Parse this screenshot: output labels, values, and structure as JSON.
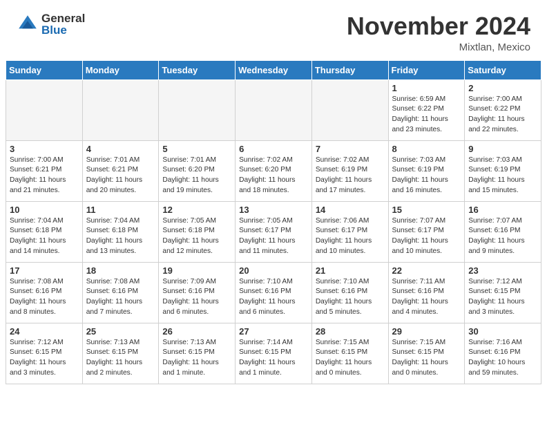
{
  "header": {
    "logo_general": "General",
    "logo_blue": "Blue",
    "month_title": "November 2024",
    "location": "Mixtlan, Mexico"
  },
  "days_of_week": [
    "Sunday",
    "Monday",
    "Tuesday",
    "Wednesday",
    "Thursday",
    "Friday",
    "Saturday"
  ],
  "weeks": [
    [
      {
        "day": "",
        "info": "",
        "empty": true
      },
      {
        "day": "",
        "info": "",
        "empty": true
      },
      {
        "day": "",
        "info": "",
        "empty": true
      },
      {
        "day": "",
        "info": "",
        "empty": true
      },
      {
        "day": "",
        "info": "",
        "empty": true
      },
      {
        "day": "1",
        "info": "Sunrise: 6:59 AM\nSunset: 6:22 PM\nDaylight: 11 hours\nand 23 minutes."
      },
      {
        "day": "2",
        "info": "Sunrise: 7:00 AM\nSunset: 6:22 PM\nDaylight: 11 hours\nand 22 minutes."
      }
    ],
    [
      {
        "day": "3",
        "info": "Sunrise: 7:00 AM\nSunset: 6:21 PM\nDaylight: 11 hours\nand 21 minutes."
      },
      {
        "day": "4",
        "info": "Sunrise: 7:01 AM\nSunset: 6:21 PM\nDaylight: 11 hours\nand 20 minutes."
      },
      {
        "day": "5",
        "info": "Sunrise: 7:01 AM\nSunset: 6:20 PM\nDaylight: 11 hours\nand 19 minutes."
      },
      {
        "day": "6",
        "info": "Sunrise: 7:02 AM\nSunset: 6:20 PM\nDaylight: 11 hours\nand 18 minutes."
      },
      {
        "day": "7",
        "info": "Sunrise: 7:02 AM\nSunset: 6:19 PM\nDaylight: 11 hours\nand 17 minutes."
      },
      {
        "day": "8",
        "info": "Sunrise: 7:03 AM\nSunset: 6:19 PM\nDaylight: 11 hours\nand 16 minutes."
      },
      {
        "day": "9",
        "info": "Sunrise: 7:03 AM\nSunset: 6:19 PM\nDaylight: 11 hours\nand 15 minutes."
      }
    ],
    [
      {
        "day": "10",
        "info": "Sunrise: 7:04 AM\nSunset: 6:18 PM\nDaylight: 11 hours\nand 14 minutes."
      },
      {
        "day": "11",
        "info": "Sunrise: 7:04 AM\nSunset: 6:18 PM\nDaylight: 11 hours\nand 13 minutes."
      },
      {
        "day": "12",
        "info": "Sunrise: 7:05 AM\nSunset: 6:18 PM\nDaylight: 11 hours\nand 12 minutes."
      },
      {
        "day": "13",
        "info": "Sunrise: 7:05 AM\nSunset: 6:17 PM\nDaylight: 11 hours\nand 11 minutes."
      },
      {
        "day": "14",
        "info": "Sunrise: 7:06 AM\nSunset: 6:17 PM\nDaylight: 11 hours\nand 10 minutes."
      },
      {
        "day": "15",
        "info": "Sunrise: 7:07 AM\nSunset: 6:17 PM\nDaylight: 11 hours\nand 10 minutes."
      },
      {
        "day": "16",
        "info": "Sunrise: 7:07 AM\nSunset: 6:16 PM\nDaylight: 11 hours\nand 9 minutes."
      }
    ],
    [
      {
        "day": "17",
        "info": "Sunrise: 7:08 AM\nSunset: 6:16 PM\nDaylight: 11 hours\nand 8 minutes."
      },
      {
        "day": "18",
        "info": "Sunrise: 7:08 AM\nSunset: 6:16 PM\nDaylight: 11 hours\nand 7 minutes."
      },
      {
        "day": "19",
        "info": "Sunrise: 7:09 AM\nSunset: 6:16 PM\nDaylight: 11 hours\nand 6 minutes."
      },
      {
        "day": "20",
        "info": "Sunrise: 7:10 AM\nSunset: 6:16 PM\nDaylight: 11 hours\nand 6 minutes."
      },
      {
        "day": "21",
        "info": "Sunrise: 7:10 AM\nSunset: 6:16 PM\nDaylight: 11 hours\nand 5 minutes."
      },
      {
        "day": "22",
        "info": "Sunrise: 7:11 AM\nSunset: 6:16 PM\nDaylight: 11 hours\nand 4 minutes."
      },
      {
        "day": "23",
        "info": "Sunrise: 7:12 AM\nSunset: 6:15 PM\nDaylight: 11 hours\nand 3 minutes."
      }
    ],
    [
      {
        "day": "24",
        "info": "Sunrise: 7:12 AM\nSunset: 6:15 PM\nDaylight: 11 hours\nand 3 minutes."
      },
      {
        "day": "25",
        "info": "Sunrise: 7:13 AM\nSunset: 6:15 PM\nDaylight: 11 hours\nand 2 minutes."
      },
      {
        "day": "26",
        "info": "Sunrise: 7:13 AM\nSunset: 6:15 PM\nDaylight: 11 hours\nand 1 minute."
      },
      {
        "day": "27",
        "info": "Sunrise: 7:14 AM\nSunset: 6:15 PM\nDaylight: 11 hours\nand 1 minute."
      },
      {
        "day": "28",
        "info": "Sunrise: 7:15 AM\nSunset: 6:15 PM\nDaylight: 11 hours\nand 0 minutes."
      },
      {
        "day": "29",
        "info": "Sunrise: 7:15 AM\nSunset: 6:15 PM\nDaylight: 11 hours\nand 0 minutes."
      },
      {
        "day": "30",
        "info": "Sunrise: 7:16 AM\nSunset: 6:16 PM\nDaylight: 10 hours\nand 59 minutes."
      }
    ]
  ]
}
